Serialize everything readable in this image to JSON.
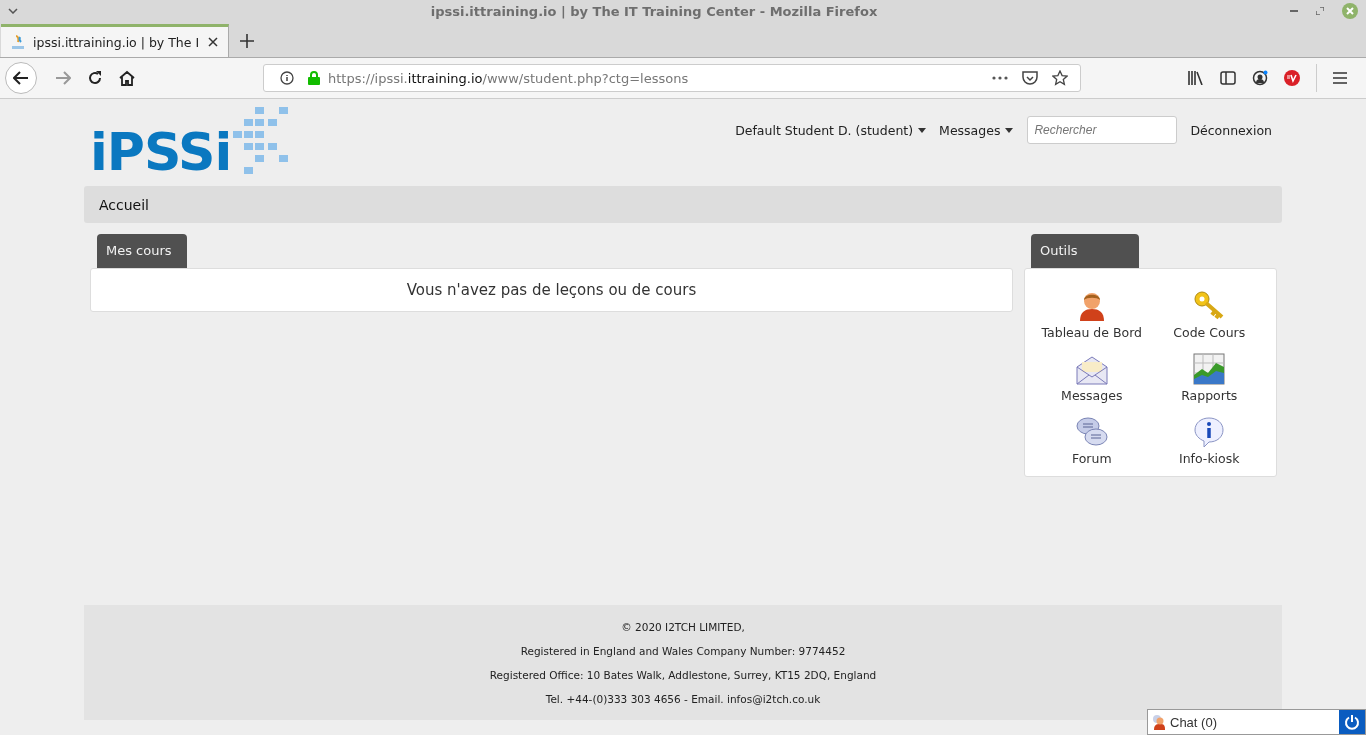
{
  "window": {
    "title": "ipssi.ittraining.io | by The IT Training Center - Mozilla Firefox"
  },
  "tabs": [
    {
      "label": "ipssi.ittraining.io | by The I",
      "selected": true
    }
  ],
  "address_bar": {
    "url_prefix": "https://ipssi.",
    "url_domain": "ittraining.io",
    "url_path": "/www/student.php?ctg=lessons",
    "secure": true
  },
  "page": {
    "logo": "iPSSi",
    "header_menu": [
      {
        "label": "Default Student D. (student)",
        "dropdown": true
      },
      {
        "label": "Messages",
        "dropdown": true
      }
    ],
    "search": {
      "placeholder": "Rechercher"
    },
    "logout": "Déconnexion",
    "breadcrumb": "Accueil",
    "courses_panel": {
      "title": "Mes cours",
      "message": "Vous n'avez pas de leçons ou de cours"
    },
    "tools_panel": {
      "title": "Outils",
      "items": [
        {
          "label": "Tableau de Bord",
          "kind": "person"
        },
        {
          "label": "Code Cours",
          "kind": "key"
        },
        {
          "label": "Messages",
          "kind": "envelope"
        },
        {
          "label": "Rapports",
          "kind": "chart"
        },
        {
          "label": "Forum",
          "kind": "bubbles"
        },
        {
          "label": "Info-kiosk",
          "kind": "info"
        }
      ]
    },
    "footer": [
      "© 2020 I2TCH LIMITED,",
      "Registered in England and Wales Company Number: 9774452",
      "Registered Office: 10 Bates Walk, Addlestone, Surrey, KT15 2DQ, England",
      "Tel. +44-(0)333 303 4656 - Email. infos@i2tch.co.uk"
    ],
    "chat": {
      "label": "Chat (0)"
    }
  }
}
